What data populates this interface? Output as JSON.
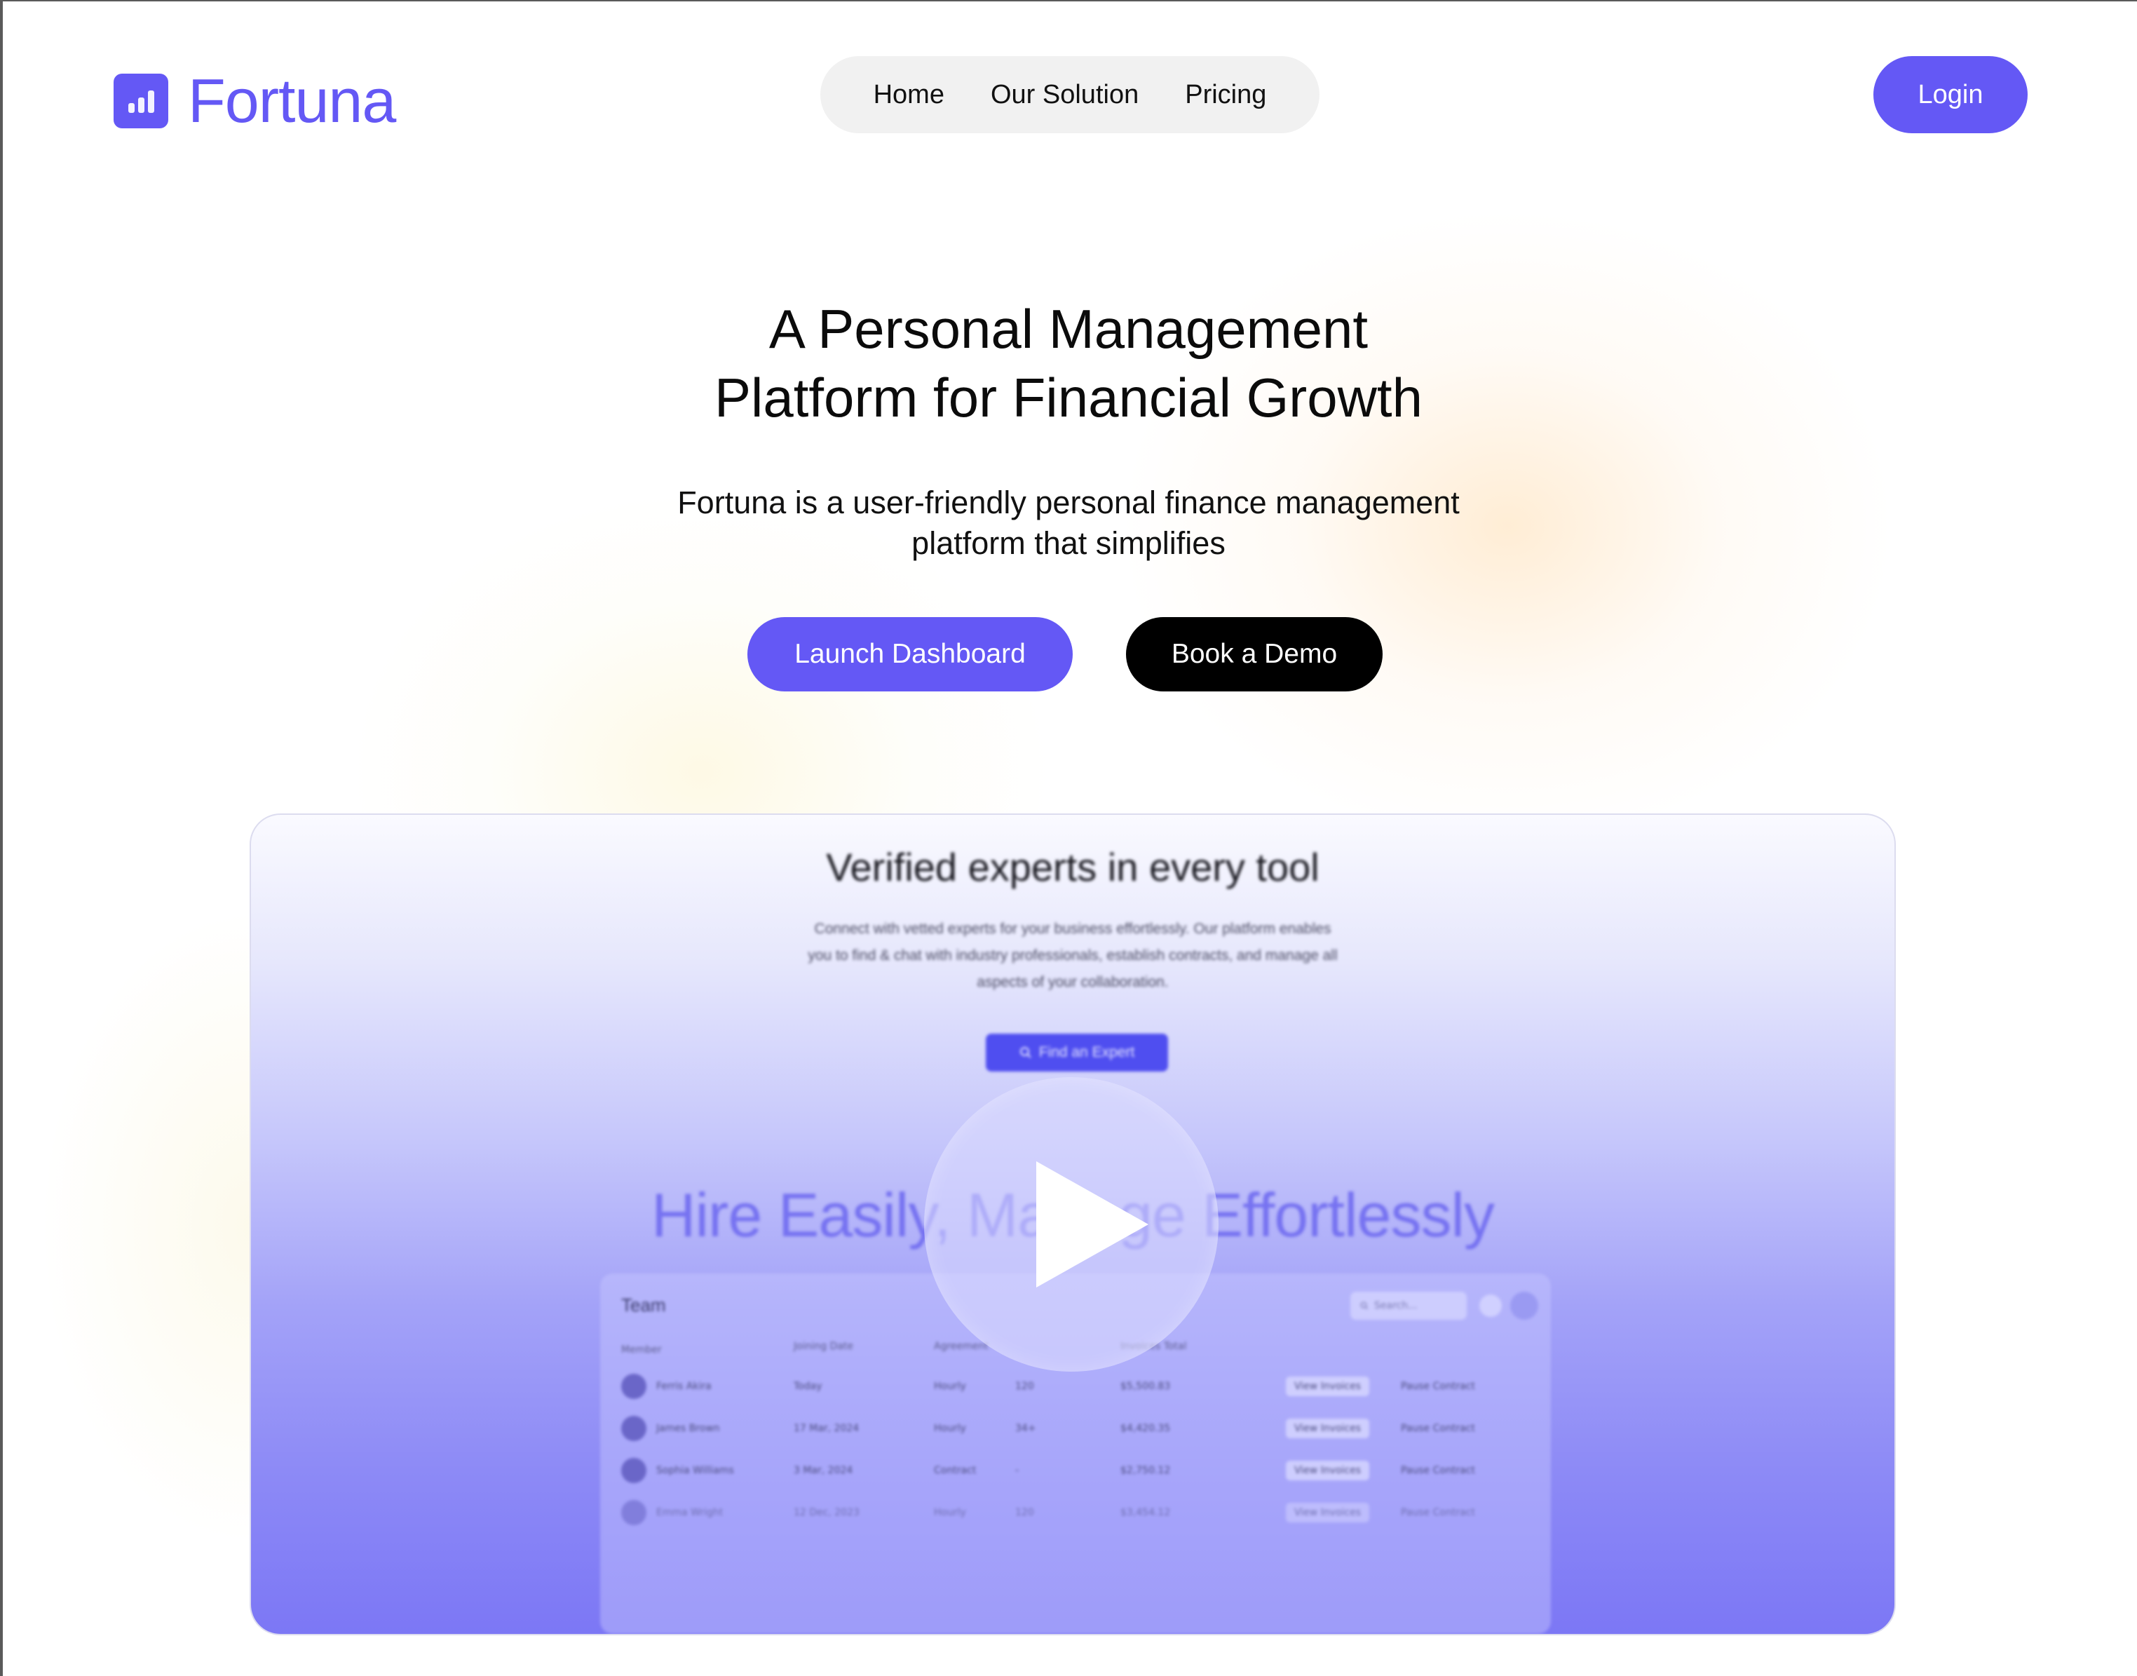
{
  "brand": {
    "name": "Fortuna",
    "accent": "#6458f5",
    "icon": "bar-chart-icon"
  },
  "nav": {
    "items": [
      {
        "label": "Home"
      },
      {
        "label": "Our Solution"
      },
      {
        "label": "Pricing"
      }
    ],
    "login_label": "Login"
  },
  "hero": {
    "title_line1": "A Personal Management",
    "title_line2": "Platform for Financial Growth",
    "subtitle_line1": "Fortuna is a user-friendly personal finance management",
    "subtitle_line2": "platform that simplifies",
    "primary_cta": "Launch Dashboard",
    "secondary_cta": "Book a Demo"
  },
  "video": {
    "title": "Verified experts in every tool",
    "description": "Connect with vetted experts for your business effortlessly. Our platform enables you to find & chat with industry professionals, establish contracts, and manage all aspects of your collaboration.",
    "find_button": "Find an Expert",
    "headline": "Hire Easily, Manage Effortlessly",
    "play_icon": "play-icon",
    "team_panel": {
      "title": "Team",
      "search_placeholder": "Search...",
      "columns": [
        "Member",
        "Joining Date",
        "Agreement",
        "",
        "Invoices Total",
        "",
        "",
        ""
      ],
      "rows": [
        {
          "member": "Ferris Akira",
          "date": "Today",
          "agreement": "Hourly",
          "rate": "120",
          "total": "$5,500.83",
          "action": "View Invoices",
          "contact": "Pause Contract"
        },
        {
          "member": "James Brown",
          "date": "17 Mar, 2024",
          "agreement": "Hourly",
          "rate": "34+",
          "total": "$4,420.35",
          "action": "View Invoices",
          "contact": "Pause Contract"
        },
        {
          "member": "Sophia Williams",
          "date": "3 Mar, 2024",
          "agreement": "Contract",
          "rate": "-",
          "total": "$2,750.12",
          "action": "View Invoices",
          "contact": "Pause Contract"
        },
        {
          "member": "Emma Wright",
          "date": "12 Dec, 2023",
          "agreement": "Hourly",
          "rate": "120",
          "total": "$3,454.12",
          "action": "View Invoices",
          "contact": "Pause Contract"
        }
      ]
    }
  }
}
